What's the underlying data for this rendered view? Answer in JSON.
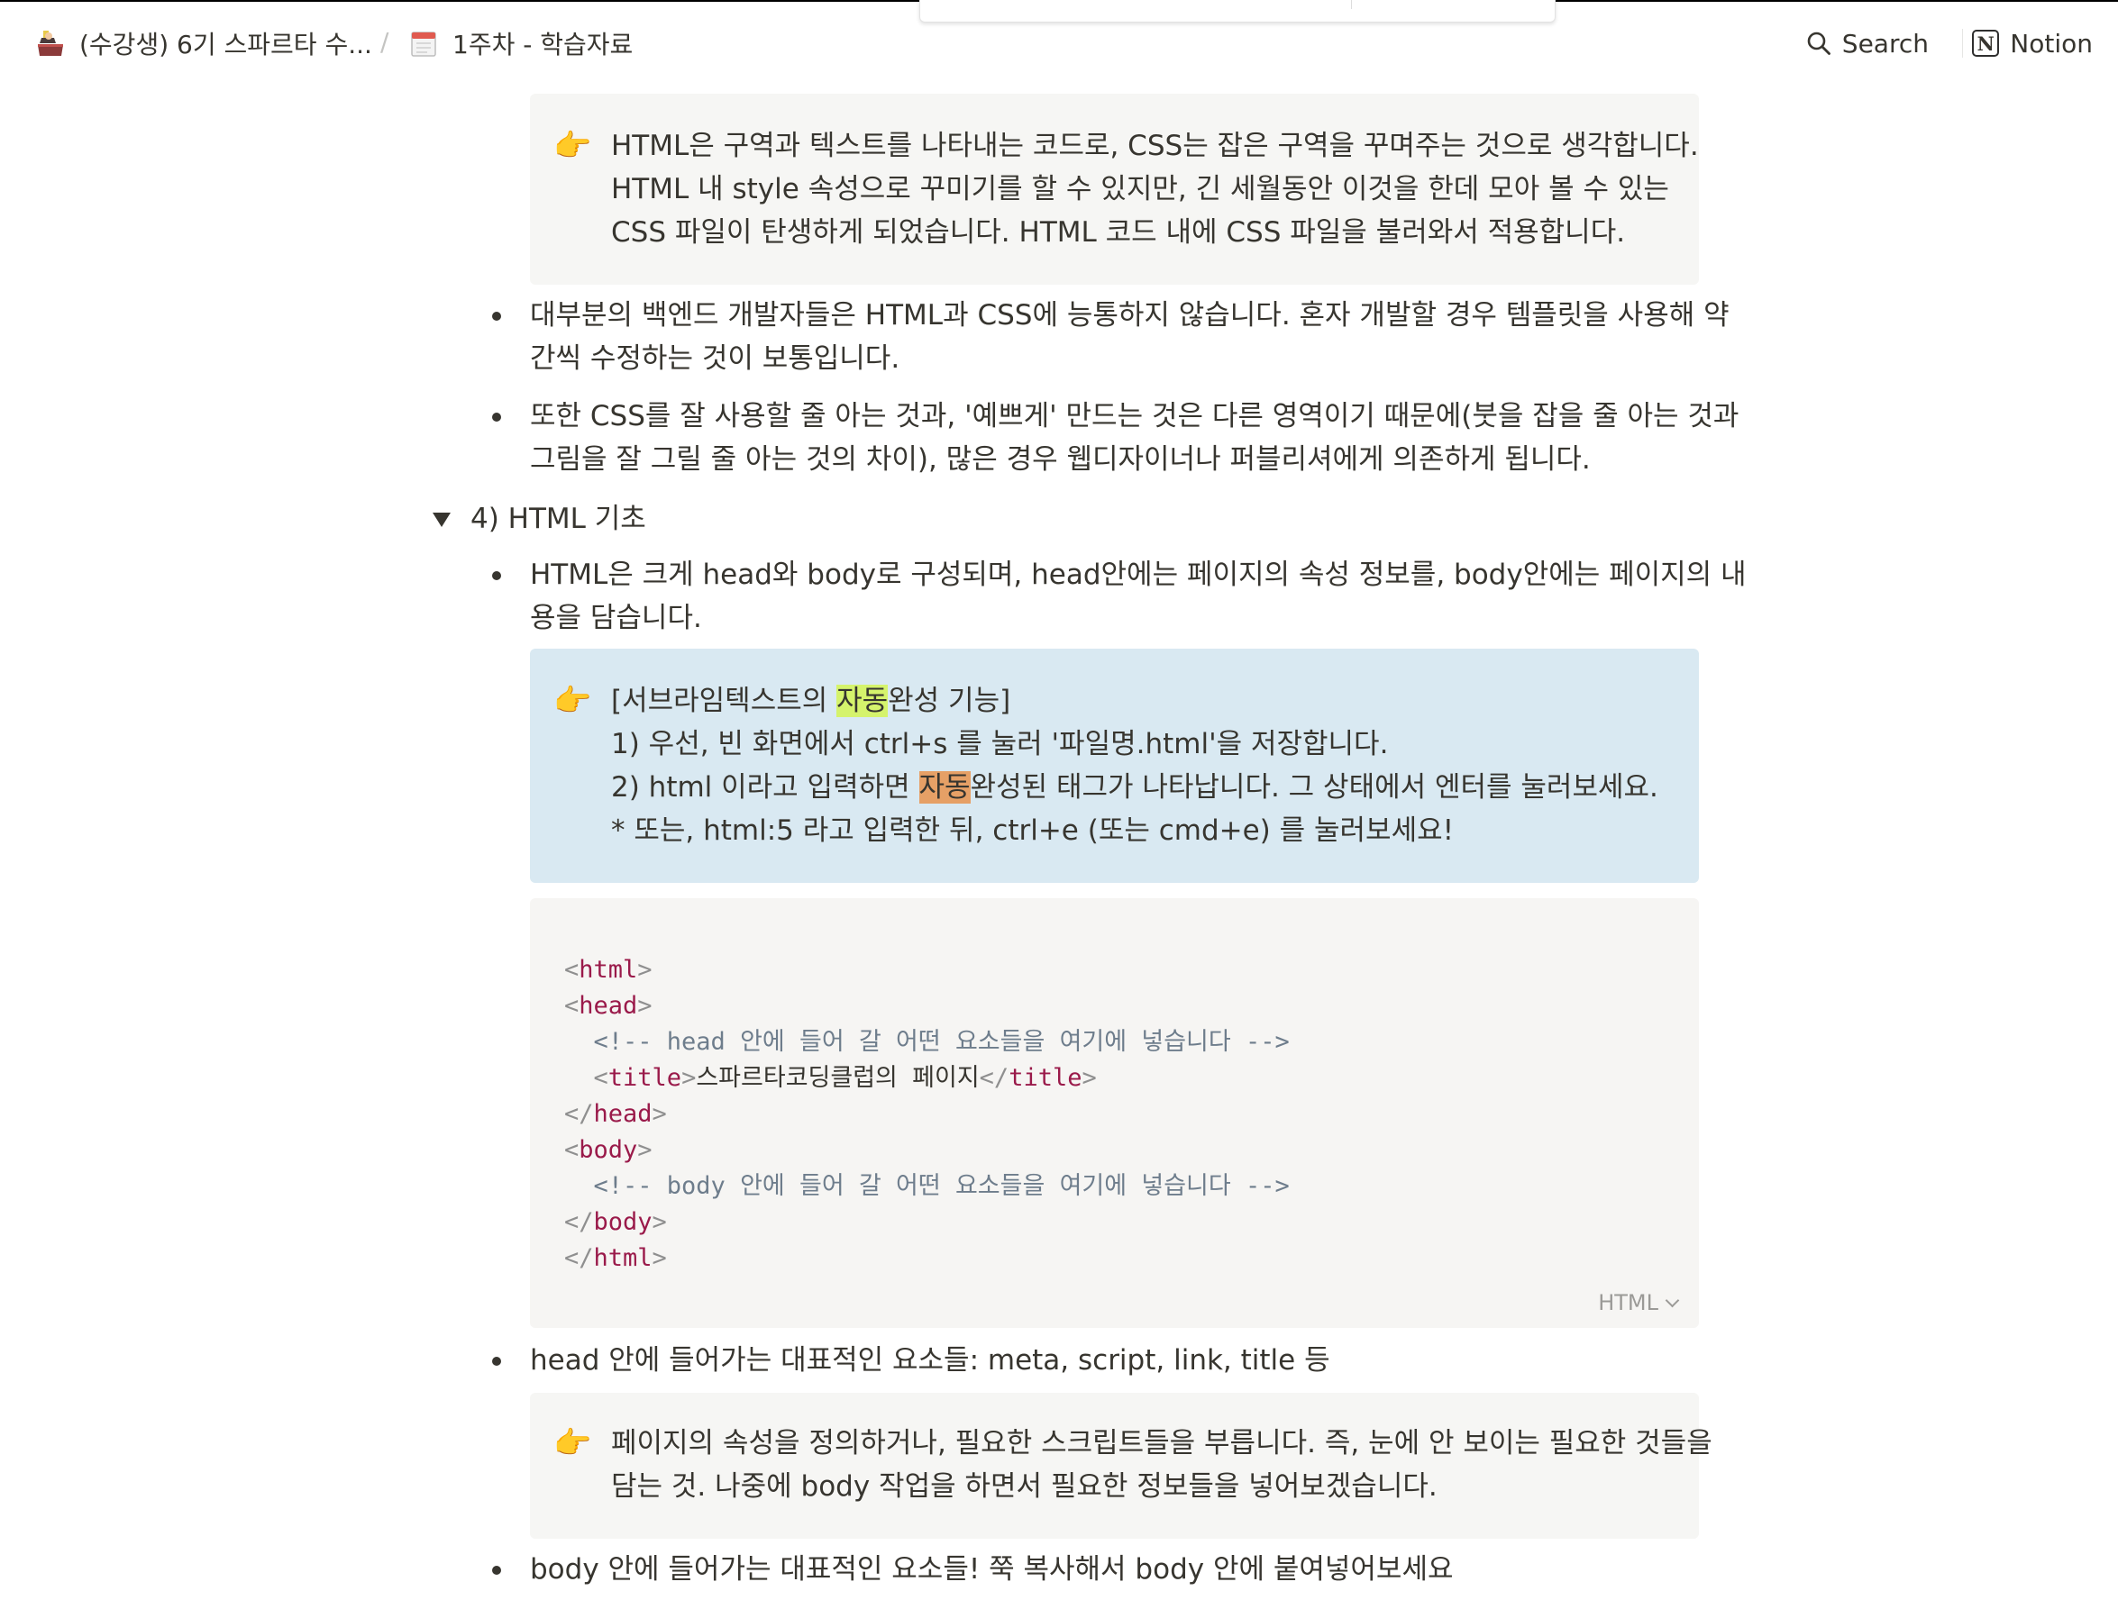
{
  "breadcrumb": {
    "workspace": "(수강생) 6기 스파르타 수...",
    "separator": "/",
    "page": "1주차 - 학습자료"
  },
  "topbar": {
    "search_label": "Search",
    "notion_label": "Notion",
    "notion_logo_letter": "N"
  },
  "callout1": {
    "emoji": "👉",
    "lines": [
      "HTML은 구역과 텍스트를 나타내는 코드로, CSS는 잡은 구역을 꾸며주는 것으로 생각합니다.",
      "HTML 내 style 속성으로 꾸미기를 할 수 있지만, 긴 세월동안 이것을 한데 모아 볼 수 있는",
      "CSS 파일이 탄생하게 되었습니다. HTML 코드 내에 CSS 파일을 불러와서 적용합니다."
    ]
  },
  "bullets_top": [
    {
      "line1": "대부분의 백엔드 개발자들은 HTML과 CSS에 능통하지 않습니다. 혼자 개발할 경우 템플릿을 사용해 약",
      "line2": "간씩 수정하는 것이 보통입니다."
    },
    {
      "line1": "또한 CSS를 잘 사용할 줄 아는 것과, '예쁘게' 만드는 것은 다른 영역이기 때문에(붓을 잡을 줄 아는 것과",
      "line2": "그림을 잘 그릴 줄 아는 것의 차이), 많은 경우 웹디자이너나 퍼블리셔에게 의존하게 됩니다."
    }
  ],
  "toggle": {
    "label": "4) HTML 기초"
  },
  "bullet_html": {
    "line1": "HTML은 크게 head와 body로 구성되며, head안에는 페이지의 속성 정보를, body안에는 페이지의 내",
    "line2": "용을 담습니다."
  },
  "callout2": {
    "emoji": "👉",
    "line1_pre": "[서브라임텍스트의 ",
    "line1_hl": "자동",
    "line1_post": "완성 기능]",
    "line2": "1) 우선, 빈 화면에서 ctrl+s 를 눌러 '파일명.html'을 저장합니다.",
    "line3_pre": "2) html 이라고 입력하면 ",
    "line3_hl": "자동",
    "line3_post": "완성된 태그가 나타납니다. 그 상태에서 엔터를 눌러보세요.",
    "line4": "* 또는, html:5 라고 입력한 뒤, ctrl+e (또는 cmd+e) 를 눌러보세요!"
  },
  "code": {
    "language": "HTML",
    "comment_head": "<!-- head 안에 들어 갈 어떤 요소들을 여기에 넣습니다 -->",
    "title_text": "스파르타코딩클럽의 페이지",
    "comment_body": "<!-- body 안에 들어 갈 어떤 요소들을 여기에 넣습니다 -->",
    "tag_html": "html",
    "tag_head": "head",
    "tag_title": "title",
    "tag_body": "body"
  },
  "bullet_head": {
    "text": "head 안에 들어가는 대표적인 요소들: meta, script, link, title 등"
  },
  "callout3": {
    "emoji": "👉",
    "lines": [
      "페이지의 속성을 정의하거나, 필요한 스크립트들을 부릅니다. 즉, 눈에 안 보이는 필요한 것들을",
      "담는 것. 나중에 body 작업을 하면서 필요한 정보들을 넣어보겠습니다."
    ]
  },
  "bullet_body": {
    "text": "body 안에 들어가는 대표적인 요소들! 쭉 복사해서 body 안에 붙여넣어보세요"
  }
}
